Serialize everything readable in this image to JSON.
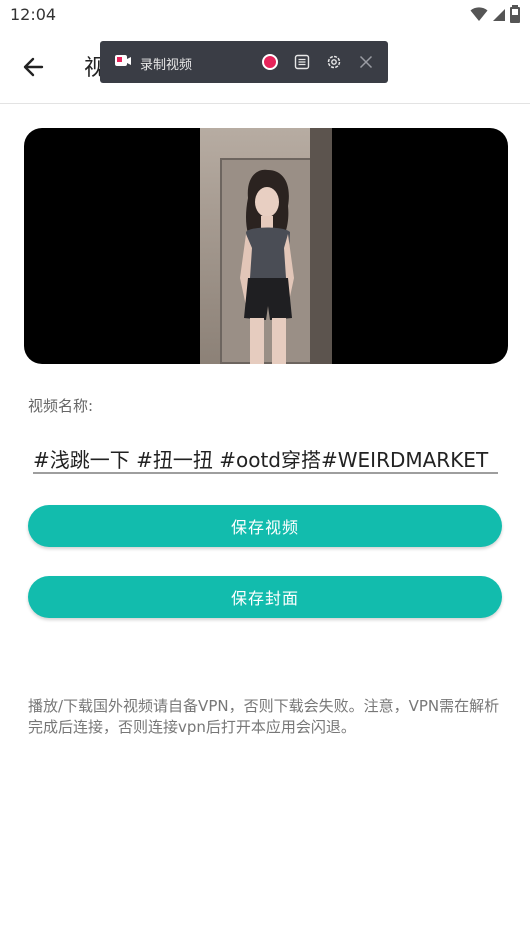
{
  "status_bar": {
    "time": "12:04",
    "icons": [
      "wifi-icon",
      "signal-icon",
      "battery-icon"
    ]
  },
  "app_bar": {
    "title": "视频详情",
    "back_icon": "arrow-left-icon"
  },
  "recording_overlay": {
    "label": "录制视频",
    "icons": [
      "camera-icon",
      "record-icon",
      "list-icon",
      "gear-icon",
      "close-icon"
    ],
    "record_color": "#e6245a"
  },
  "video": {
    "background": "#000000"
  },
  "form": {
    "name_label": "视频名称:",
    "name_value": "#浅跳一下 #扭一扭 #ootd穿搭#WEIRDMARKET"
  },
  "buttons": {
    "save_video": "保存视频",
    "save_cover": "保存封面"
  },
  "notice": "播放/下载国外视频请自备VPN，否则下载会失败。注意，VPN需在解析完成后连接，否则连接vpn后打开本应用会闪退。",
  "colors": {
    "accent": "#12bcad"
  }
}
